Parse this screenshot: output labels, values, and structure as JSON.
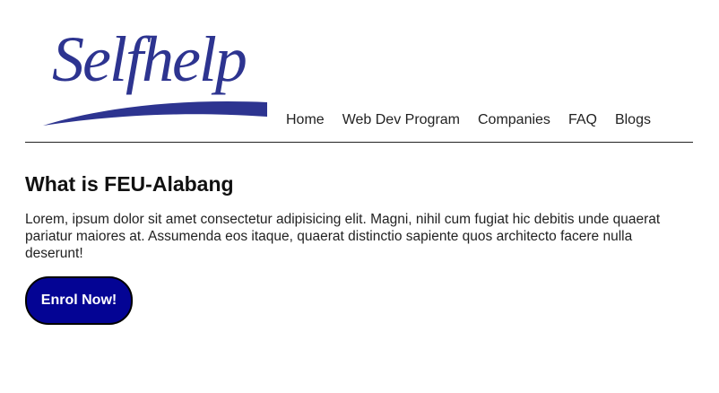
{
  "header": {
    "logo_text": "Selfhelp",
    "nav": [
      {
        "label": "Home"
      },
      {
        "label": "Web Dev Program"
      },
      {
        "label": "Companies"
      },
      {
        "label": "FAQ"
      },
      {
        "label": "Blogs"
      }
    ]
  },
  "main": {
    "title": "What is FEU-Alabang",
    "paragraph": "Lorem, ipsum dolor sit amet consectetur adipisicing elit. Magni, nihil cum fugiat hic debitis unde quaerat pariatur maiores at. Assumenda eos itaque, quaerat distinctio sapiente quos architecto facere nulla deserunt!",
    "cta_label": "Enrol Now!"
  },
  "colors": {
    "logo": "#2d3490",
    "button_bg": "#040494",
    "button_text": "#ffffff",
    "divider": "#222222"
  }
}
